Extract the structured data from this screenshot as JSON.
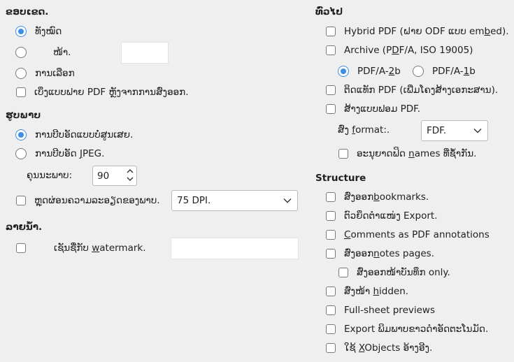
{
  "range": {
    "heading": "ຂອບເຂດ.",
    "all": "ທັງໝົດ",
    "pages_label": "ໜ້າ.",
    "pages_value": "",
    "selection": "ການເລືອກ",
    "view_after": "ເບິ່ງແບບຟາຍ PDF ຫຼັງຈາກການສົ່ງອອກ."
  },
  "images": {
    "heading": "ຮູບພາບ",
    "lossless": "ການບີບອັດແບບບໍ່ສູນເສຍ.",
    "jpeg_pre": "ການບີບອັດ ",
    "jpeg_u": "J",
    "jpeg_post": "PEG.",
    "quality_label": "ຄຸນນະພາບ:",
    "quality_value": "90",
    "reduce_label": "ຫຼຸດຜ່ອນຄວາມລະອຽດຂອງພາບ.",
    "reduce_value": "75 DPI."
  },
  "watermark": {
    "heading": "ລາຍນ້ຳ.",
    "sign_pre": "ເຊັນຊື່ກັບ ",
    "sign_u": "w",
    "sign_post": "atermark.",
    "text_value": ""
  },
  "general": {
    "heading": "ທົ່ວໄປ",
    "hybrid_pre": "Hybrid PDF (ຝາຍ ODF ແບບ em",
    "hybrid_u": "b",
    "hybrid_post": "ed).",
    "archive_pre": "Archive (P",
    "archive_u": "D",
    "archive_post": "F/A, ISO 19005)",
    "pdfa2b_pre": "PDF/A-",
    "pdfa2b_u": "2",
    "pdfa2b_post": "b",
    "pdfa1b_pre": "PDF/A-",
    "pdfa1b_u": "1",
    "pdfa1b_post": "b",
    "tagged": "ຕິດແທັກ PDF (ເພີ່ມໂຄງສ້າງເອກະສານ).",
    "create_form": "ສ້າງແບບຟອມ PDF.",
    "submit_pre": "ສົ່ງ ",
    "submit_u": "f",
    "submit_post": "ormat:.",
    "submit_value": "FDF.",
    "allow_dup_pre": "ອະນຸຍາດຟິດ ",
    "allow_dup_u": "n",
    "allow_dup_post": "ames ທີ່ຊ້ຳກັນ."
  },
  "structure": {
    "heading": "Structure",
    "export_bm_pre": "ສົ່ງອອກ",
    "export_bm_u": "b",
    "export_bm_post": "ookmarks.",
    "placeholders": "ຕົວຍຶດຕຳແໜ່ງ Export.",
    "comments_pre": "",
    "comments_u": "C",
    "comments_post": "omments as PDF annotations",
    "notes_pre": "ສົ່ງອອກ",
    "notes_u": "n",
    "notes_post": "otes pages.",
    "notes_only": "ສົ່ງອອກໜ້າບັນທຶກ only.",
    "hidden_pre": "ສົ່ງໜ້າ ",
    "hidden_u": "h",
    "hidden_post": "idden.",
    "fullsheet": "Full-sheet previews",
    "auto_pre": "Export ພິມພາບຂາວດຳອັດຕະໂນມັດ.",
    "xobjects_pre": "ໃຊ້ ",
    "xobjects_u": "X",
    "xobjects_post": "Objects ອ້າງອີງ."
  }
}
